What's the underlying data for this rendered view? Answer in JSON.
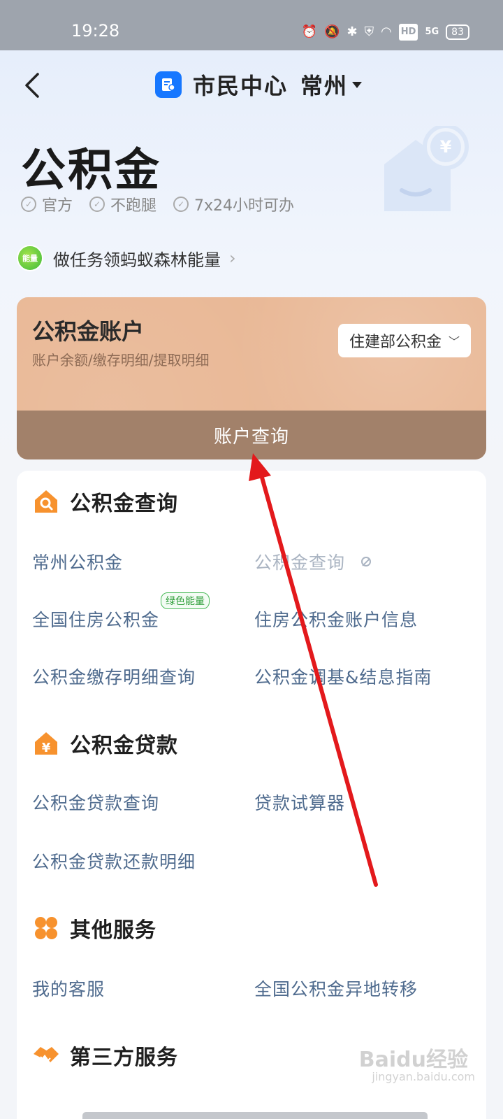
{
  "status_bar": {
    "time": "19:28",
    "battery": "83",
    "icons": [
      "alarm-icon",
      "mute-bell-icon",
      "bluetooth-icon",
      "shield-icon",
      "wifi-icon",
      "hd-icon",
      "5g-signal-icon",
      "battery-icon"
    ],
    "hd_label": "HD",
    "net_label": "5G"
  },
  "nav": {
    "title": "市民中心",
    "city": "常州"
  },
  "hero": {
    "title": "公积金",
    "tags": [
      "官方",
      "不跑腿",
      "7x24小时可办"
    ]
  },
  "energy": {
    "badge": "能量",
    "text": "做任务领蚂蚁森林能量"
  },
  "account_card": {
    "title": "公积金账户",
    "subtitle": "账户余额/缴存明细/提取明细",
    "select_value": "住建部公积金",
    "query_button": "账户查询",
    "color": "#e9b896",
    "button_color": "#a2816a"
  },
  "sections": [
    {
      "title": "公积金查询",
      "icon": "house-search-icon",
      "items": [
        "常州公积金",
        "公积金查询",
        "全国住房公积金",
        "住房公积金账户信息",
        "公积金缴存明细查询",
        "公积金调基&结息指南"
      ],
      "badge": "绿色能量"
    },
    {
      "title": "公积金贷款",
      "icon": "house-yen-icon",
      "items": [
        "公积金贷款查询",
        "贷款试算器",
        "公积金贷款还款明细"
      ]
    },
    {
      "title": "其他服务",
      "icon": "four-petal-icon",
      "items": [
        "我的客服",
        "全国公积金异地转移"
      ]
    },
    {
      "title": "第三方服务",
      "icon": "handshake-icon",
      "items": []
    }
  ],
  "watermark": {
    "text": "Baidu经验",
    "sub": "jingyan.baidu.com"
  },
  "colors": {
    "accent_orange": "#f7922e",
    "link_blue": "#4f6b8e",
    "annotation_red": "#e3191c"
  }
}
